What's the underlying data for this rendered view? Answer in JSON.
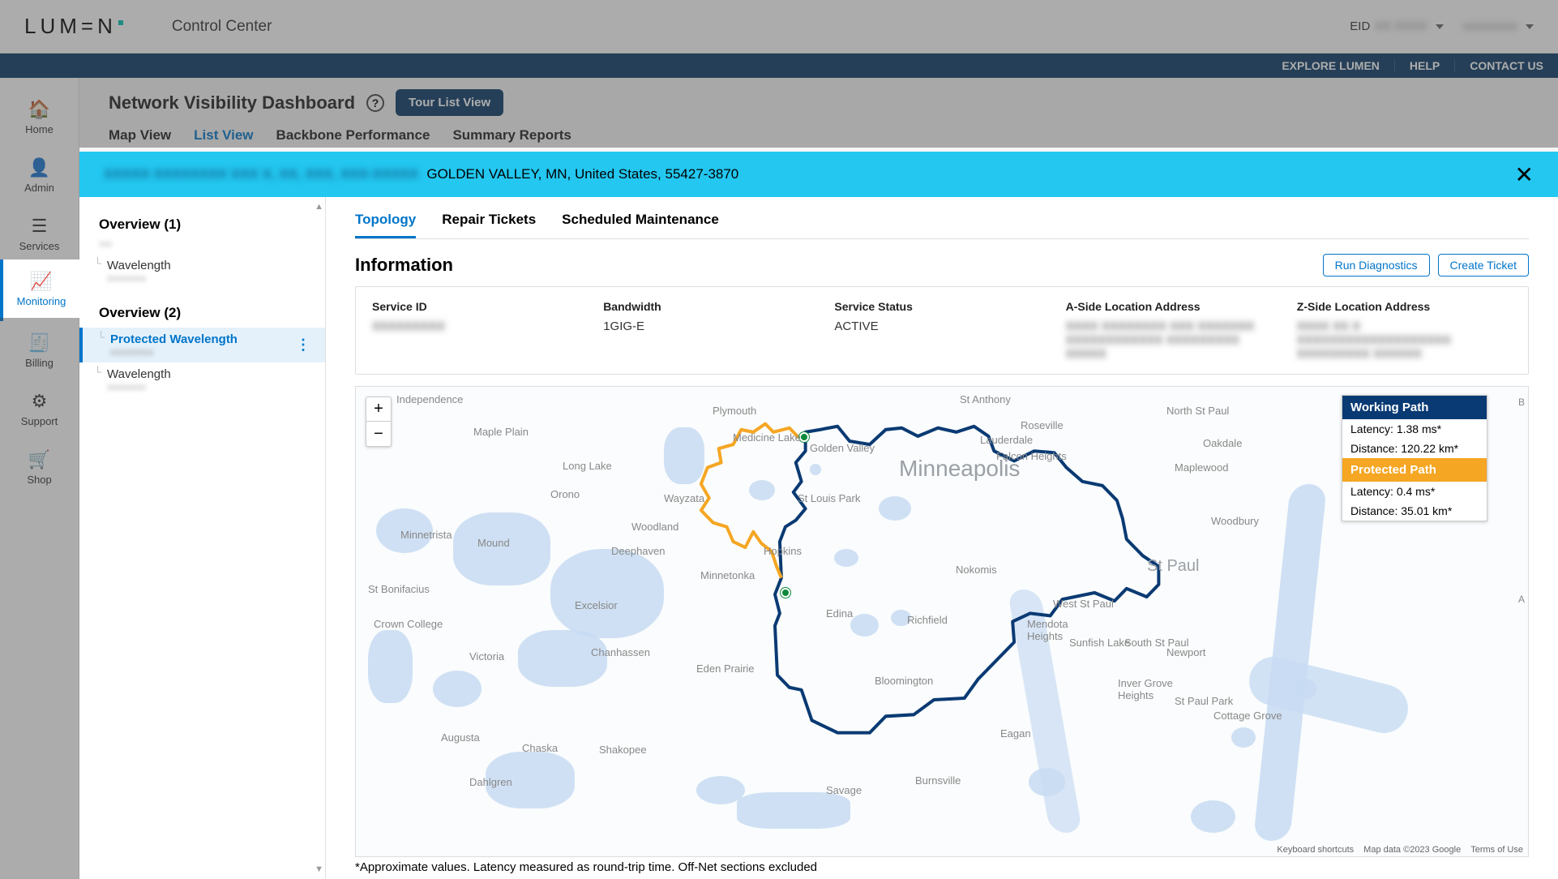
{
  "brand": "LUM=N",
  "app_title": "Control Center",
  "topbar_right": {
    "eid_label": "EID",
    "eid_value": "XX XXXX",
    "user": "xxxxxxxxx"
  },
  "utilbar": {
    "explore": "EXPLORE LUMEN",
    "help": "HELP",
    "contact": "CONTACT US"
  },
  "rail": [
    {
      "key": "home",
      "label": "Home",
      "icon": "⌂"
    },
    {
      "key": "admin",
      "label": "Admin",
      "icon": "☻"
    },
    {
      "key": "services",
      "label": "Services",
      "icon": "≡"
    },
    {
      "key": "monitoring",
      "label": "Monitoring",
      "icon": "〰"
    },
    {
      "key": "billing",
      "label": "Billing",
      "icon": "▤"
    },
    {
      "key": "support",
      "label": "Support",
      "icon": "✿"
    },
    {
      "key": "shop",
      "label": "Shop",
      "icon": "🛒"
    }
  ],
  "rail_active": "monitoring",
  "page": {
    "title": "Network Visibility Dashboard",
    "tour_btn": "Tour List View",
    "subtabs": [
      "Map View",
      "List View",
      "Backbone Performance",
      "Summary Reports"
    ],
    "subtab_active": "List View"
  },
  "banner": {
    "blur_prefix": "XXXXX XXXXXXXX XXX X, XX, XXX, XXX-XXXXX",
    "location": "GOLDEN VALLEY, MN, United States, 55427-3870"
  },
  "sidelist": {
    "groups": [
      {
        "title": "Overview (1)",
        "items": [
          {
            "label": "Wavelength",
            "sub": "xxxxxxxx"
          }
        ]
      },
      {
        "title": "Overview (2)",
        "items": [
          {
            "label": "Protected Wavelength",
            "sub": "xxxxxxxx",
            "selected": true
          },
          {
            "label": "Wavelength",
            "sub": "xxxxxxxx"
          }
        ]
      }
    ]
  },
  "detail_tabs": {
    "items": [
      "Topology",
      "Repair Tickets",
      "Scheduled Maintenance"
    ],
    "active": "Topology"
  },
  "info": {
    "heading": "Information",
    "run_diag": "Run Diagnostics",
    "create_ticket": "Create Ticket",
    "cols": {
      "service_id": {
        "h": "Service ID",
        "v_blur": "XXXXXXXXX"
      },
      "bandwidth": {
        "h": "Bandwidth",
        "v": "1GIG-E"
      },
      "status": {
        "h": "Service Status",
        "v": "ACTIVE"
      },
      "a_side": {
        "h": "A-Side Location Address",
        "v_blur": "XXXX XXXXXXXX XXX XXXXXXX\nXXXXXXXXXXXX XXXXXXXXX\nXXXXX"
      },
      "z_side": {
        "h": "Z-Side Location Address",
        "v_blur": "XXXX XX X\nXXXXXXXXXXXXXXXXXXX\nXXXXXXXXX XXXXXX"
      }
    }
  },
  "legend": {
    "working": {
      "title": "Working Path",
      "latency": "Latency: 1.38 ms*",
      "distance": "Distance: 120.22 km*"
    },
    "protected": {
      "title": "Protected Path",
      "latency": "Latency: 0.4 ms*",
      "distance": "Distance: 35.01 km*"
    }
  },
  "map": {
    "zoom_in": "+",
    "zoom_out": "−",
    "labels": {
      "minneapolis": "Minneapolis",
      "stpaul": "St Paul",
      "independence": "Independence",
      "plymouth": "Plymouth",
      "medicine_lake": "Medicine Lake",
      "golden_valley": "Golden Valley",
      "maple_plain": "Maple Plain",
      "long_lake": "Long Lake",
      "orono": "Orono",
      "wayzata": "Wayzata",
      "woodland": "Woodland",
      "deephaven": "Deephaven",
      "minnetrista": "Minnetrista",
      "mound": "Mound",
      "st_bonifacius": "St Bonifacius",
      "crown": "Crown College",
      "victoria": "Victoria",
      "excelsior": "Excelsior",
      "chanhassen": "Chanhassen",
      "minnetonka": "Minnetonka",
      "hopkins": "Hopkins",
      "st_louis_park": "St Louis Park",
      "edina": "Edina",
      "richfield": "Richfield",
      "bloomington": "Bloomington",
      "eden_prairie": "Eden Prairie",
      "shakopee": "Shakopee",
      "chaska": "Chaska",
      "dahlgren": "Dahlgren",
      "augusta": "Augusta",
      "savage": "Savage",
      "burnsville": "Burnsville",
      "eagan": "Eagan",
      "mendota": "Mendota\nHeights",
      "sunfish": "Sunfish Lake",
      "west_stpaul": "West St Paul",
      "south_stpaul": "South St Paul",
      "inver_grove": "Inver Grove\nHeights",
      "newport": "Newport",
      "st_paul_park": "St Paul Park",
      "cottage_grove": "Cottage Grove",
      "woodbury": "Woodbury",
      "maplewood": "Maplewood",
      "oakdale": "Oakdale",
      "north_stpaul": "North St Paul",
      "st_anthony": "St Anthony",
      "roseville": "Roseville",
      "lauderdale": "Lauderdale",
      "falcon": "Falcon Heights",
      "nokomis": "Nokomis"
    },
    "scroll_a": "A",
    "scroll_b": "B",
    "attr": {
      "kb": "Keyboard shortcuts",
      "data": "Map data ©2023 Google",
      "terms": "Terms of Use"
    },
    "footnote": "*Approximate values. Latency measured as round-trip time. Off-Net sections excluded"
  },
  "colors": {
    "accent": "#0075c9",
    "banner": "#23c7f0",
    "navy": "#0a3a66",
    "working": "#0a3a73",
    "protected": "#f5a623"
  }
}
